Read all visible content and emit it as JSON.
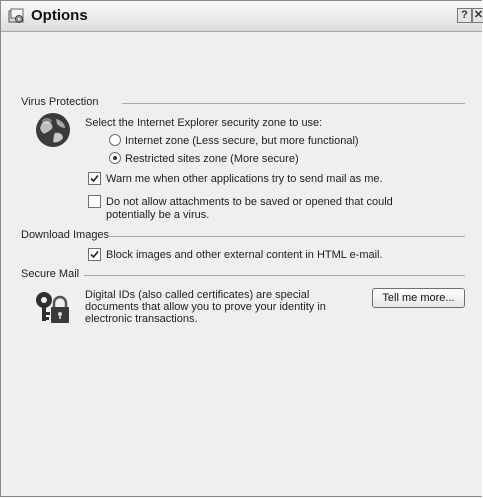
{
  "window": {
    "title": "Options",
    "help_label": "?",
    "close_label": "✕"
  },
  "virus": {
    "section_title": "Virus Protection",
    "zone_prompt": "Select the Internet Explorer security zone to use:",
    "zone_options": [
      {
        "label": "Internet zone (Less secure, but more functional)",
        "selected": false
      },
      {
        "label": "Restricted sites zone (More secure)",
        "selected": true
      }
    ],
    "warn_label": "Warn me when other applications try to send mail as me.",
    "warn_checked": true,
    "attach_label_line1": "Do not allow attachments to be saved or opened that could",
    "attach_label_line2": "potentially be a virus.",
    "attach_checked": false
  },
  "download": {
    "section_title": "Download Images",
    "block_label": "Block images and other external content in HTML e-mail.",
    "block_checked": true
  },
  "secure": {
    "section_title": "Secure Mail",
    "desc_line1": "Digital IDs (also called certificates) are special",
    "desc_line2": "documents that allow you to prove your identity in",
    "desc_line3": "electronic transactions.",
    "tell_button": "Tell me more..."
  },
  "icons": {
    "title": "options-window-icon",
    "virus": "globe-shield-icon",
    "secure": "key-lock-icon"
  }
}
